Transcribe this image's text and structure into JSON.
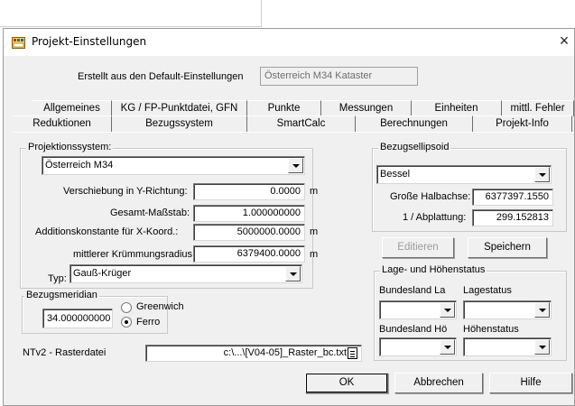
{
  "window": {
    "title": "Projekt-Einstellungen",
    "close": "×"
  },
  "header": {
    "created_from_label": "Erstellt aus den Default-Einstellungen",
    "created_from_value": "Österreich M34 Kataster"
  },
  "tabs_row1": [
    "Allgemeines",
    "KG / FP-Punktdatei, GFN",
    "Punkte",
    "Messungen",
    "Einheiten",
    "mittl. Fehler"
  ],
  "tabs_row2": [
    "Reduktionen",
    "Bezugssystem",
    "SmartCalc",
    "Berechnungen",
    "Projekt-Info"
  ],
  "projection": {
    "group_title": "Projektionssystem:",
    "system_value": "Österreich M34",
    "shift_y_label": "Verschiebung in Y-Richtung:",
    "shift_y_value": "0.0000",
    "shift_y_unit": "m",
    "scale_label": "Gesamt-Maßstab:",
    "scale_value": "1.000000000",
    "add_x_label": "Additionskonstante für X-Koord.:",
    "add_x_value": "5000000.0000",
    "add_x_unit": "m",
    "radius_label": "mittlerer Krümmungsradius:",
    "radius_value": "6379400.0000",
    "radius_unit": "m",
    "type_label": "Typ:",
    "type_value": "Gauß-Krüger"
  },
  "meridian": {
    "group_title": "Bezugsmeridian",
    "value": "34.000000000",
    "greenwich_label": "Greenwich",
    "ferro_label": "Ferro",
    "selected": "Ferro"
  },
  "ntv2": {
    "label": "NTv2 - Rasterdatei",
    "value": "c:\\...\\[V04-05]_Raster_bc.txt"
  },
  "ellipsoid": {
    "group_title": "Bezugsellipsoid",
    "value": "Bessel",
    "semi_major_label": "Große Halbachse:",
    "semi_major_value": "6377397.1550",
    "flattening_label": "1 / Abplattung:",
    "flattening_value": "299.152813",
    "edit_button": "Editieren",
    "save_button": "Speichern"
  },
  "status": {
    "group_title": "Lage- und Höhenstatus",
    "state_pos_label": "Bundesland La",
    "pos_status_label": "Lagestatus",
    "state_height_label": "Bundesland Hö",
    "height_status_label": "Höhenstatus"
  },
  "footer": {
    "ok": "OK",
    "cancel": "Abbrechen",
    "help": "Hilfe"
  }
}
